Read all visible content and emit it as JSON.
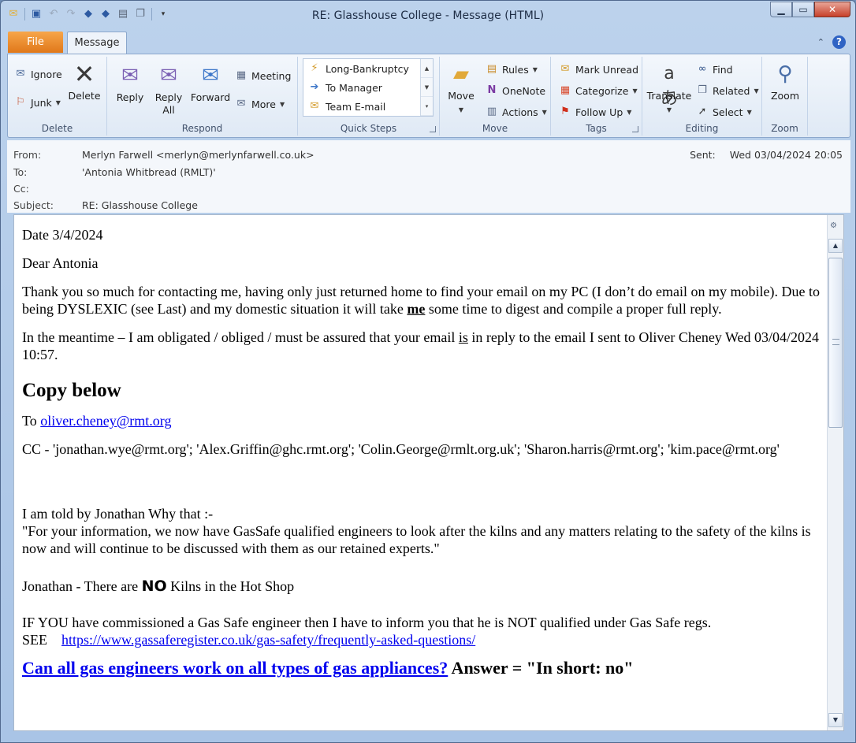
{
  "window": {
    "title": "RE: Glasshouse College  -  Message (HTML)"
  },
  "qat": {
    "icons": [
      "mail-icon",
      "save-icon",
      "undo-icon",
      "redo-icon",
      "previous-icon",
      "next-icon",
      "print-icon",
      "copy-icon",
      "customize-icon"
    ]
  },
  "tabs": {
    "file": "File",
    "message": "Message"
  },
  "ribbon": {
    "delete_group": {
      "label": "Delete",
      "ignore": "Ignore",
      "junk": "Junk",
      "delete": "Delete"
    },
    "respond_group": {
      "label": "Respond",
      "reply": "Reply",
      "reply_all_1": "Reply",
      "reply_all_2": "All",
      "forward": "Forward",
      "meeting": "Meeting",
      "more": "More"
    },
    "quicksteps_group": {
      "label": "Quick Steps",
      "items": [
        "Long-Bankruptcy",
        "To Manager",
        "Team E-mail"
      ]
    },
    "move_group": {
      "label": "Move",
      "move": "Move",
      "rules": "Rules",
      "onenote": "OneNote",
      "actions": "Actions"
    },
    "tags_group": {
      "label": "Tags",
      "mark_unread": "Mark Unread",
      "categorize": "Categorize",
      "follow_up": "Follow Up"
    },
    "editing_group": {
      "label": "Editing",
      "translate": "Translate",
      "find": "Find",
      "related": "Related",
      "select": "Select"
    },
    "zoom_group": {
      "label": "Zoom",
      "zoom": "Zoom"
    }
  },
  "header": {
    "from_label": "From:",
    "from_value": "Merlyn Farwell <merlyn@merlynfarwell.co.uk>",
    "to_label": "To:",
    "to_value": "'Antonia Whitbread (RMLT)'",
    "cc_label": "Cc:",
    "cc_value": "",
    "subject_label": "Subject:",
    "subject_value": "RE: Glasshouse College",
    "sent_label": "Sent:",
    "sent_value": "Wed 03/04/2024 20:05"
  },
  "body": {
    "date": "Date 3/4/2024",
    "greeting": "Dear Antonia",
    "p1_a": "Thank you so much for contacting me, having only just returned home to find your email on my PC (I don’t do email on my mobile). Due to being DYSLEXIC (see Last) and my domestic situation it will take ",
    "p1_me": "me",
    "p1_b": " some time to digest and compile a proper full reply.",
    "p2_a": "In the meantime – I am obligated / obliged / must be assured that your email ",
    "p2_is": "is",
    "p2_b": " in reply to the email I sent to Oliver Cheney Wed 03/04/2024 10:57.",
    "heading": "Copy below",
    "to_prefix": "To ",
    "to_link": "oliver.cheney@rmt.org",
    "cc_line": "CC - 'jonathan.wye@rmt.org'; 'Alex.Griffin@ghc.rmt.org'; 'Colin.George@rmlt.org.uk'; 'Sharon.harris@rmt.org'; 'kim.pace@rmt.org'",
    "told_intro": "I am told by Jonathan Why that :-",
    "told_quote": "\"For your information, we now have GasSafe qualified engineers to look after the kilns and any matters relating to the safety of the kilns is now and will continue to be discussed with them as our retained experts.\"",
    "kilns_a": "Jonathan - There are ",
    "kilns_no": "NO",
    "kilns_b": " Kilns in the Hot Shop",
    "gas_a": "IF YOU have commissioned a Gas Safe engineer then I have to inform you that he is NOT qualified under Gas Safe regs.",
    "see_label": "SEE",
    "see_link": "https://www.gassaferegister.co.uk/gas-safety/frequently-asked-questions/",
    "qa_link": "Can all gas engineers work on all types of gas appliances?",
    "qa_answer": " Answer =  \"In short: no\""
  }
}
